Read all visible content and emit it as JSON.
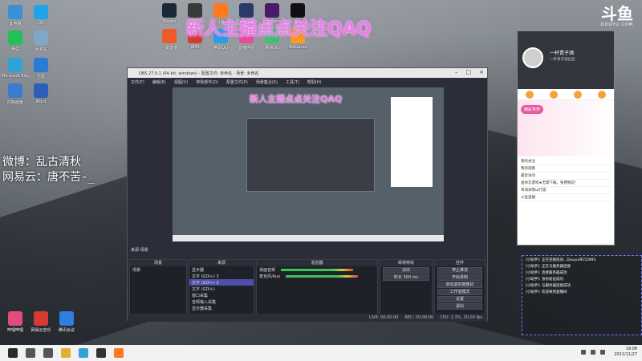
{
  "desktop": {
    "banner_text": "新人主播点点关注QAQ",
    "weibo_line1": "微博：乱古清秋",
    "weibo_line2": "网易云：唐不苦-_",
    "icons_left": [
      {
        "label": "此电脑",
        "color": "#3a8fd6"
      },
      {
        "label": "QQ",
        "color": "#1fa4e8"
      },
      {
        "label": "微信",
        "color": "#23c05a"
      },
      {
        "label": "回收站",
        "color": "#7fa8c8"
      },
      {
        "label": "Microsoft Edge",
        "color": "#2fa3d6"
      },
      {
        "label": "迅雷",
        "color": "#2a7ad8"
      },
      {
        "label": "控制面板",
        "color": "#3d7bd0"
      },
      {
        "label": "Word",
        "color": "#2b5fb8"
      },
      {
        "label": "哔哩哔哩",
        "color": "#e24c7c"
      },
      {
        "label": "网易云音乐",
        "color": "#d73a32"
      },
      {
        "label": "腾讯会议",
        "color": "#2f7ee5"
      }
    ],
    "icons_top": [
      {
        "label": "Steam",
        "color": "#1b2838"
      },
      {
        "label": "OBS",
        "color": "#3a3a3a"
      },
      {
        "label": "斗鱼",
        "color": "#ff7a1e"
      },
      {
        "label": "Photoshop",
        "color": "#2b3a67"
      },
      {
        "label": "Premiere",
        "color": "#4a1b6b"
      },
      {
        "label": "剪映",
        "color": "#111"
      },
      {
        "label": "一键直播",
        "color": "#f05a28"
      },
      {
        "label": "WPS",
        "color": "#d63a32"
      },
      {
        "label": "腾讯QQ",
        "color": "#23a0e8"
      },
      {
        "label": "直播伴侣",
        "color": "#ea4b9a"
      },
      {
        "label": "网易UU",
        "color": "#3dc46a"
      },
      {
        "label": "WeGame",
        "color": "#ff9a1a"
      }
    ],
    "logo_mark": "斗鱼",
    "logo_sub": "DOUYU.COM"
  },
  "obs": {
    "title": "OBS 27.0.1 (64-bit, windows) - 配置文件: 未命名 - 场景: 未命名",
    "menu": [
      "文件(F)",
      "编辑(E)",
      "视图(V)",
      "停靠部件(D)",
      "配置文件(P)",
      "场景集合(S)",
      "工具(T)",
      "帮助(H)"
    ],
    "preview_banner": "新人主播点点关注QAQ",
    "scene_header": "来源 场景",
    "docks": {
      "scenes_title": "场景",
      "sources_title": "来源",
      "mixer_title": "混音器",
      "transitions_title": "转场特效",
      "controls_title": "控件"
    },
    "scenes": [
      "场景"
    ],
    "sources": [
      "显示器",
      "文字 (GDI+) 3",
      "文字 (GDI+) 2",
      "文字 (GDI+)",
      "窗口采集",
      "音频输入采集",
      "显示器采集"
    ],
    "mixer_items": [
      "桌面音频",
      "麦克风/Aux"
    ],
    "transition": "淡出",
    "transition_duration": "时长 300 ms",
    "controls": [
      "停止推流",
      "开始录制",
      "启动虚拟摄像机",
      "工作室模式",
      "设置",
      "退出"
    ],
    "status": [
      "LIVE: 00:00:00",
      "REC: 00:00:00",
      "CPU: 1.3%, 30.00 fps"
    ]
  },
  "douyu_panel": {
    "title": "一杆青子酒",
    "subtitle": "一杆青子酒出品",
    "banner_badge": "精彩世界",
    "list_items": [
      "我的关注",
      "我的观看",
      "最近访问",
      "送你云游戏★无需下载，免费畅玩!",
      "青海海鄂山行旅",
      "斗鱼直播"
    ]
  },
  "chat": {
    "lines": [
      "[小助手]: 正在连接房间...Douyu/9152993",
      "[小助手]: 正在与服务器连接",
      "[小助手]: 连接服务器成功",
      "[小助手]: 身份验证成功",
      "[小助手]: 与服务器连接成功",
      "[小助手]: 欢迎来到直播间"
    ]
  },
  "taskbar": {
    "time": "19:08",
    "date": "2021/11/27",
    "icons": [
      {
        "name": "start",
        "color": "#2b2b2b"
      },
      {
        "name": "search",
        "color": "#555"
      },
      {
        "name": "taskview",
        "color": "#555"
      },
      {
        "name": "chrome",
        "color": "#e0b030"
      },
      {
        "name": "edge",
        "color": "#2fa3d6"
      },
      {
        "name": "obs",
        "color": "#333"
      },
      {
        "name": "douyu",
        "color": "#ff7a1e"
      }
    ]
  }
}
